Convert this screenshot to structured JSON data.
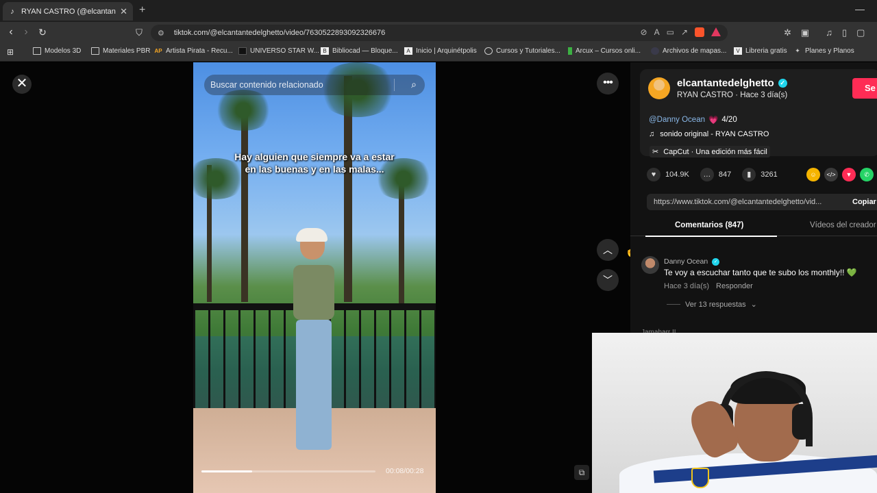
{
  "browser": {
    "tab_title": "RYAN CASTRO (@elcantantedelg",
    "url": "tiktok.com/@elcantantedelghetto/video/7630522893092326676",
    "bookmarks": [
      {
        "label": "Modelos 3D",
        "icon": "folder-icon"
      },
      {
        "label": "Materiales PBR",
        "icon": "folder-icon"
      },
      {
        "label": "Artista Pirata - Recu...",
        "icon": "ap-icon"
      },
      {
        "label": "UNIVERSO STAR W...",
        "icon": "star-wars-icon"
      },
      {
        "label": "Bibliocad — Bloque...",
        "icon": "bibliocad-icon"
      },
      {
        "label": "Inicio | Arquinétpolis",
        "icon": "arquinetpolis-icon"
      },
      {
        "label": "Cursos y Tutoriales...",
        "icon": "globe-icon"
      },
      {
        "label": "Arcux – Cursos onli...",
        "icon": "arcux-icon"
      },
      {
        "label": "Archivos de mapas...",
        "icon": "map-icon"
      },
      {
        "label": "Libreria gratis",
        "icon": "libreria-icon"
      },
      {
        "label": "Planes y Planos",
        "icon": "planes-icon"
      }
    ]
  },
  "video": {
    "search_placeholder": "Buscar contenido relacionado",
    "caption": "Hay alguien que siempre va a estar en las buenas y en las malas...",
    "time": "00:08/00:28",
    "progress": 0.29
  },
  "creator": {
    "username": "elcantantedelghetto",
    "subtitle": "RYAN CASTRO · Hace 3 día(s)",
    "follow_label": "Se",
    "mention": "@Danny Ocean",
    "date_tag": "4/20",
    "sound": "sonido original - RYAN CASTRO",
    "capcut": "CapCut · Una edición más fácil"
  },
  "stats": {
    "likes": "104.9K",
    "comments": "847",
    "saves": "3261"
  },
  "link": {
    "url": "https://www.tiktok.com/@elcantantedelghetto/vid...",
    "copy_label": "Copiar e"
  },
  "tabs": {
    "comments": "Comentarios (847)",
    "creator_videos": "Vídeos del creador"
  },
  "comment": {
    "author": "Danny Ocean",
    "text": "Te voy a escuchar tanto que te subo los monthly!! 💚",
    "time": "Hace 3 día(s)",
    "reply": "Responder",
    "view_replies": "Ver 13 respuestas"
  },
  "comment2_author": "Jamaharr II",
  "colors": {
    "accent_red": "#fe2c55",
    "verified": "#20d5ec",
    "mention": "#8ab8e8"
  }
}
